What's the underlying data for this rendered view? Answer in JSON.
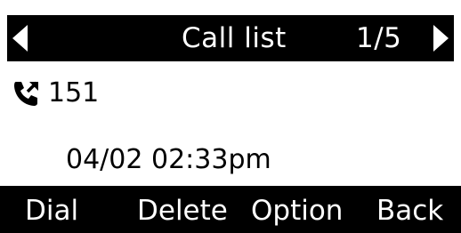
{
  "header": {
    "title": "Call list",
    "page_indicator": "1/5",
    "left_icon": "arrow-left-icon",
    "right_icon": "arrow-right-icon"
  },
  "entry": {
    "icon": "outgoing-call-icon",
    "number": "151",
    "datetime": "04/02 02:33pm"
  },
  "softkeys": {
    "dial": "Dial",
    "delete": "Delete",
    "option": "Option",
    "back": "Back"
  },
  "colors": {
    "bar_background": "#000000",
    "bar_text": "#ffffff",
    "screen_background": "#ffffff",
    "text": "#000000"
  }
}
